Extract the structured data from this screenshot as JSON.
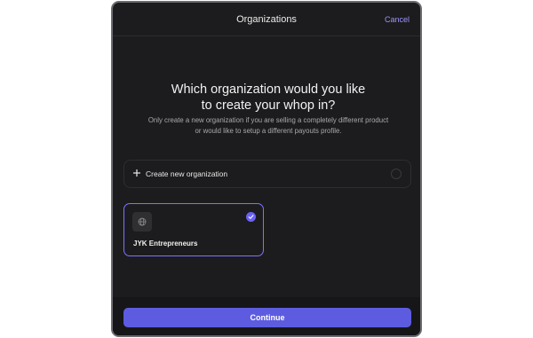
{
  "header": {
    "title": "Organizations",
    "cancel_label": "Cancel"
  },
  "main": {
    "question": "Which organization would you like to create your whop in?",
    "subtext": "Only create a new organization if you are selling a completely different product or would like to setup a different payouts profile."
  },
  "create_option": {
    "label": "Create new organization",
    "icon": "plus-icon",
    "selected": false
  },
  "organizations": [
    {
      "name": "JYK Entrepreneurs",
      "icon": "globe-icon",
      "selected": true
    }
  ],
  "footer": {
    "continue_label": "Continue"
  },
  "colors": {
    "accent": "#5d5ce0",
    "selected_border": "#7c74ff",
    "cancel_link": "#9a94ff",
    "background": "#1c1c1e"
  }
}
